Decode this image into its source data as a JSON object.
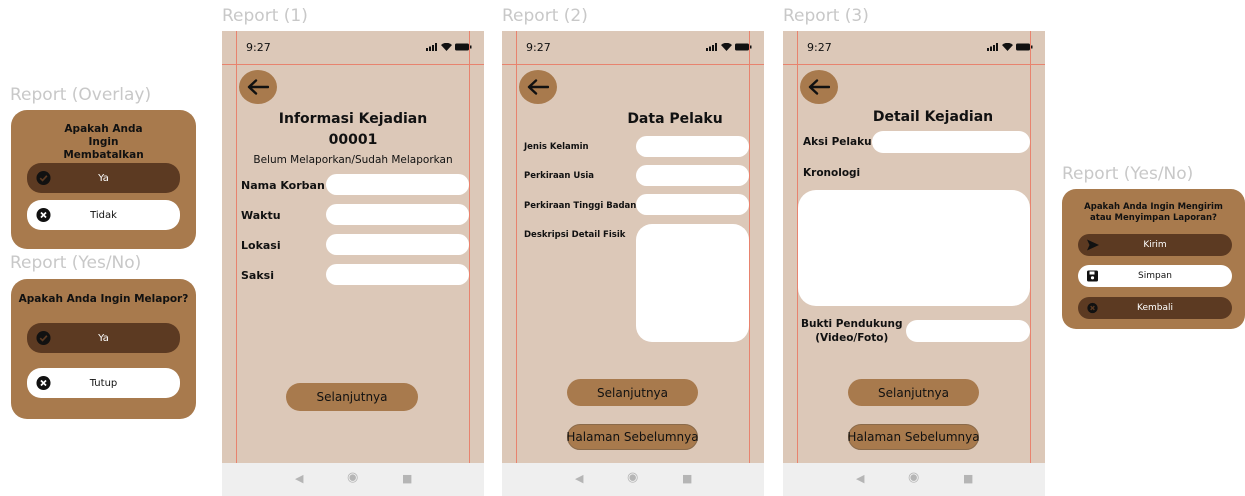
{
  "frames": {
    "report1": "Report (1)",
    "report2": "Report (2)",
    "report3": "Report (3)",
    "overlay": "Report (Overlay)",
    "yesno_left": "Report (Yes/No)",
    "yesno_right": "Report (Yes/No)"
  },
  "status": {
    "time": "9:27"
  },
  "overlay_cancel": {
    "question": "Apakah Anda Ingin Membatalkan Laporan?",
    "yes_label": "Ya",
    "no_label": "Tidak"
  },
  "overlay_report": {
    "question": "Apakah Anda Ingin Melapor?",
    "yes_label": "Ya",
    "close_label": "Tutup"
  },
  "overlay_submit": {
    "question": "Apakah Anda Ingin Mengirim atau Menyimpan Laporan?",
    "send_label": "Kirim",
    "save_label": "Simpan",
    "back_label": "Kembali"
  },
  "report1": {
    "title_line1": "Informasi Kejadian",
    "title_line2": "00001",
    "subtitle": "Belum Melaporkan/Sudah Melaporkan",
    "fields": [
      "Nama Korban",
      "Waktu",
      "Lokasi",
      "Saksi"
    ],
    "next_label": "Selanjutnya"
  },
  "report2": {
    "title": "Data Pelaku",
    "fields": [
      "Jenis Kelamin",
      "Perkiraan Usia",
      "Perkiraan Tinggi Badan",
      "Deskripsi  Detail Fisik"
    ],
    "next_label": "Selanjutnya",
    "prev_label": "Halaman Sebelumnya"
  },
  "report3": {
    "title": "Detail Kejadian",
    "action_label": "Aksi Pelaku",
    "chronology_label": "Kronologi",
    "evidence_line1": "Bukti Pendukung",
    "evidence_line2": "(Video/Foto)",
    "next_label": "Selanjutnya",
    "prev_label": "Halaman Sebelumnya"
  },
  "icons": {
    "back": "arrow-left-icon",
    "check": "check-circle-icon",
    "close": "x-circle-icon",
    "send": "send-icon",
    "save": "floppy-disk-icon",
    "nav_back": "triangle-left-icon",
    "nav_home": "circle-icon",
    "nav_recent": "square-icon"
  },
  "colors": {
    "phone_bg": "#dcc8b8",
    "brown": "#a87a4d",
    "dark_brown": "#5c3a22",
    "field": "#ffffff",
    "guide": "#e8836e",
    "label": "#c8c8c8"
  }
}
